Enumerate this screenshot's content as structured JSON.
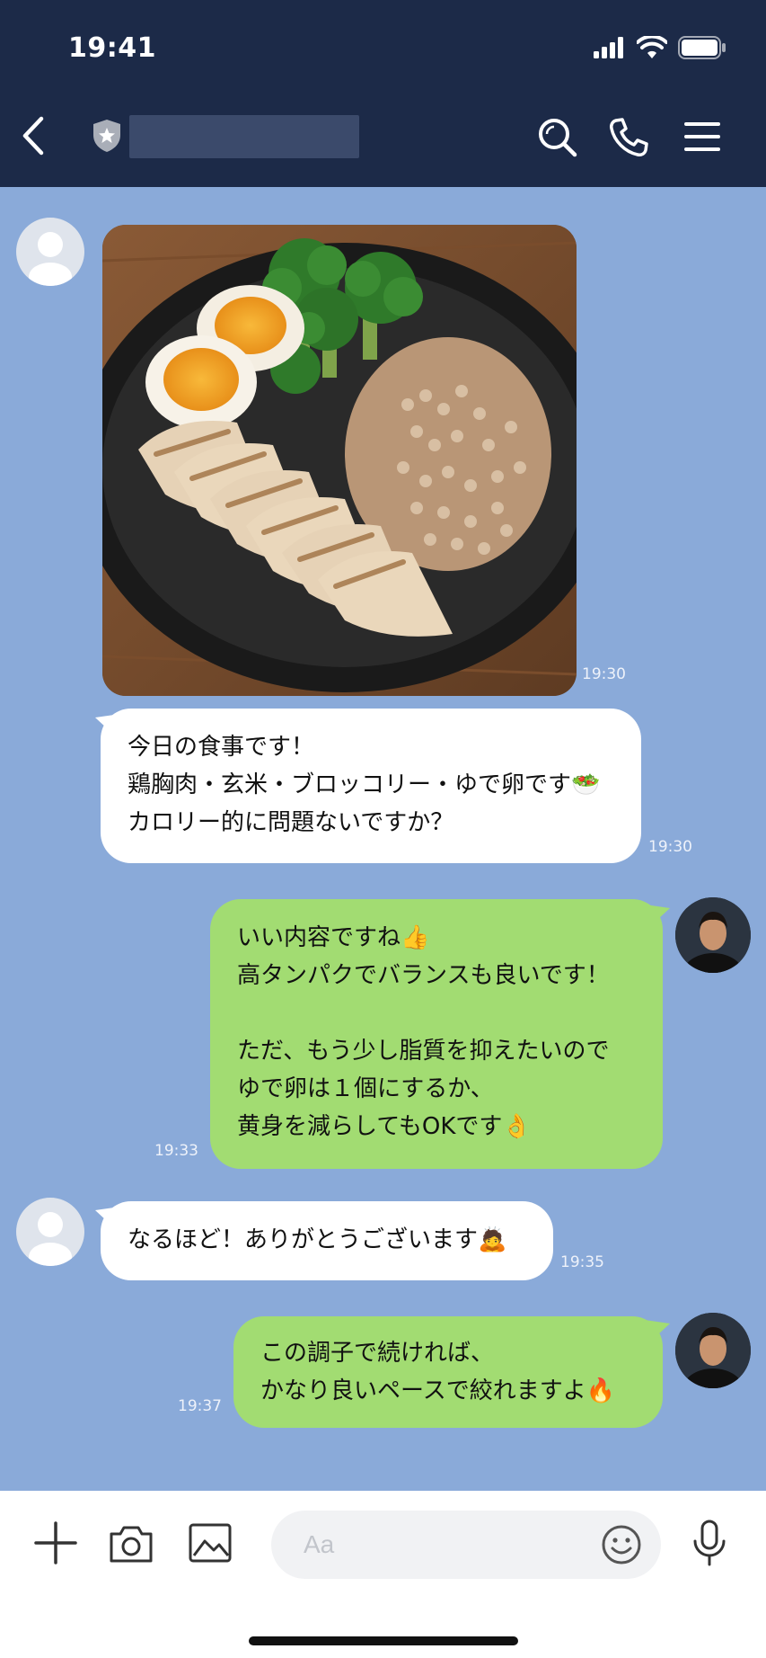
{
  "status_bar": {
    "time": "19:41"
  },
  "header": {
    "back_icon": "chevron-left-icon",
    "shield_icon": "shield-star-icon"
  },
  "messages": [
    {
      "type": "photo",
      "time": "19:30",
      "sender": "user"
    },
    {
      "type": "text",
      "sender": "user",
      "time": "19:30",
      "lines": [
        "今日の食事です！",
        "鶏胸肉・玄米・ブロッコリー・ゆで卵です🥗",
        "カロリー的に問題ないですか？"
      ]
    },
    {
      "type": "text",
      "sender": "trainer",
      "time": "19:33",
      "lines": [
        "いい内容ですね👍",
        "高タンパクでバランスも良いです！",
        "",
        "ただ、もう少し脂質を抑えたいので",
        "ゆで卵は１個にするか、",
        "黄身を減らしてもOKです👌"
      ]
    },
    {
      "type": "text",
      "sender": "user",
      "time": "19:35",
      "lines": [
        "なるほど！ありがとうございます🙇"
      ]
    },
    {
      "type": "text",
      "sender": "trainer",
      "time": "19:37",
      "lines": [
        "この調子で続ければ、",
        "かなり良いペースで絞れますよ🔥"
      ]
    }
  ],
  "composer": {
    "placeholder": "Aa"
  },
  "colors": {
    "header_bg": "#1c2a48",
    "chat_bg": "#8aaad9",
    "bubble_green": "#a2dc72",
    "bubble_white": "#ffffff"
  }
}
